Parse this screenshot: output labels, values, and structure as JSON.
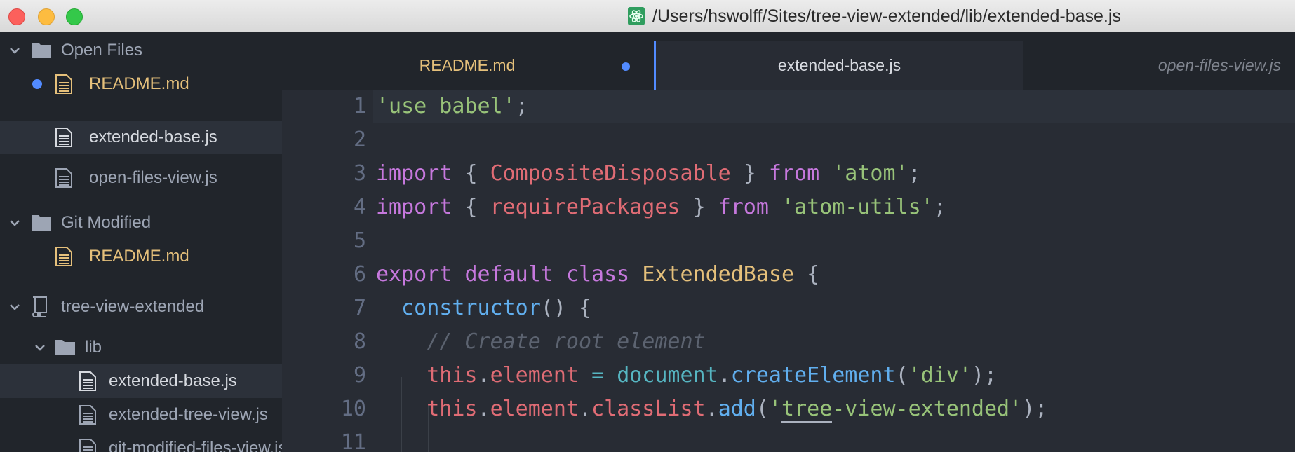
{
  "window": {
    "title": "/Users/hswolff/Sites/tree-view-extended/lib/extended-base.js"
  },
  "sidebar": {
    "sections": [
      {
        "label": "Open Files"
      },
      {
        "label": "Git Modified"
      },
      {
        "label": "tree-view-extended"
      }
    ],
    "open_files": [
      "README.md",
      "extended-base.js",
      "open-files-view.js"
    ],
    "git_modified": [
      "README.md"
    ],
    "folder_lib": "lib",
    "lib_files": [
      "extended-base.js",
      "extended-tree-view.js",
      "git-modified-files-view.js"
    ]
  },
  "tabs": [
    {
      "label": "README.md",
      "modified": true
    },
    {
      "label": "extended-base.js",
      "active": true
    },
    {
      "label": "open-files-view.js",
      "preview": true
    }
  ],
  "editor": {
    "line_numbers": [
      "1",
      "2",
      "3",
      "4",
      "5",
      "6",
      "7",
      "8",
      "9",
      "10",
      "11"
    ]
  },
  "colors": {
    "accent": "#528bff",
    "modified": "#e5c07b",
    "keyword": "#c678dd",
    "string": "#98c379",
    "variable": "#e06c75",
    "function": "#61afef"
  }
}
